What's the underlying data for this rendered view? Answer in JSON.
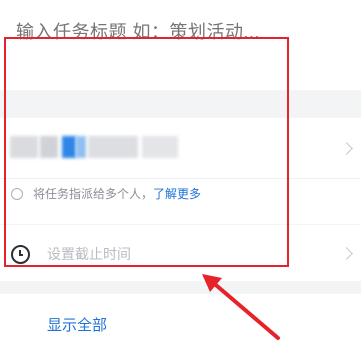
{
  "task_form": {
    "title_placeholder": "输入任务标题 如：策划活动...",
    "assignee": {
      "hint_prefix": "将任务指派给多个人，",
      "learn_more": "了解更多"
    },
    "deadline": {
      "placeholder": "设置截止时间"
    },
    "show_all_label": "显示全部"
  },
  "colors": {
    "accent": "#1f73d6",
    "highlight": "#e6232b",
    "background": "#f3f4f6"
  }
}
